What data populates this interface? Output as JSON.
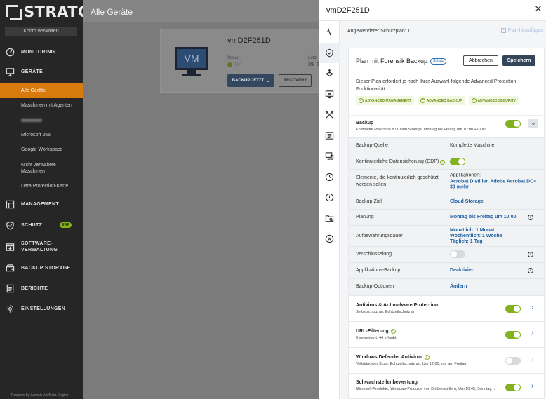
{
  "sidebar": {
    "logo": "STRATO",
    "account_button": "Konto verwalten",
    "sections": {
      "monitoring": "MONITORING",
      "devices": "GERÄTE",
      "management": "MANAGEMENT",
      "protection": "SCHUTZ",
      "protection_badge": "EAP",
      "software": "SOFTWARE-\nVERWALTUNG",
      "storage": "BACKUP STORAGE",
      "reports": "BERICHTE",
      "settings": "EINSTELLUNGEN"
    },
    "device_items": {
      "all": "Alle Geräte",
      "with_agents": "Maschinen mit Agenten",
      "m365": "Microsoft 365",
      "gworkspace": "Google Workspace",
      "unmanaged": "Nicht verwaltete Maschinen",
      "dp_map": "Data Protection-Karte"
    },
    "footer": "Powered by Acronis AnyData Engine"
  },
  "main": {
    "title": "Alle Geräte",
    "device": {
      "name": "vmD2F251D",
      "icon_text": "VM",
      "status_label": "Status",
      "status_value": "OK",
      "last_label": "Letzt",
      "last_value": "29. Ju",
      "backup_now": "BACKUP JETZT",
      "recovery": "RECOVERY"
    }
  },
  "panel": {
    "title": "vmD2F251D",
    "applied_plan": "Angewendeter Schutzplan: 1",
    "add_plan": "Plan hinzufügen",
    "plan": {
      "name": "Plan mit Forensik Backup",
      "badge": "Schutz",
      "cancel": "Abbrechen",
      "save": "Speichern",
      "description": "Dieser Plan erfordert je nach Ihrer Auswahl folgende Advanced Protection-Funktionalität:",
      "features": [
        "ADVANCED MANAGEMENT",
        "ADVANCED BACKUP",
        "ADVANCED SECURITY"
      ]
    },
    "backup": {
      "title": "Backup",
      "subtitle": "Komplette Maschine zu Cloud Storage, Montag bis Freitag um 10:00 + CDP",
      "enabled": true
    },
    "settings": {
      "source_label": "Backup-Quelle",
      "source_value": "Komplette Maschine",
      "cdp_label": "Kontinuierliche Datensicherung (CDP)",
      "cdp_enabled": true,
      "elements_label": "Elemente, die kontinuierlich geschützt werden sollen",
      "elements_prefix": "Applikationen:",
      "elements_value": "Acrobat Distiller, Adobe Acrobat DC+ 39 mehr",
      "target_label": "Backup-Ziel",
      "target_value": "Cloud Storage",
      "schedule_label": "Planung",
      "schedule_value": "Montag bis Freitag um 10:00",
      "retention_label": "Aufbewahrungsdauer",
      "retention_values": [
        "Monatlich: 1 Monat",
        "Wöchentlich: 1 Woche",
        "Täglich: 1 Tag"
      ],
      "encryption_label": "Verschlüsselung",
      "encryption_enabled": false,
      "app_backup_label": "Applikations-Backup",
      "app_backup_value": "Deaktiviert",
      "options_label": "Backup-Optionen",
      "options_value": "Ändern"
    },
    "modules": [
      {
        "title": "Antivirus & Antimalware Protection",
        "subtitle": "Selbstschutz an, Echtzeitschutz an",
        "enabled": true,
        "badge": false
      },
      {
        "title": "URL-Filterung",
        "subtitle": "0 verweigert, 44 erlaubt",
        "enabled": true,
        "badge": true
      },
      {
        "title": "Windows Defender Antivirus",
        "subtitle": "Vollständiger Scan, Echtzeitschutz an, Um 12:00, nur am Freitag",
        "enabled": false,
        "badge": true
      },
      {
        "title": "Schwachstellenbewertung",
        "subtitle": "Microsoft-Produkte, Windows-Produkte von Drittherstellern, Um 10:45, Sonntag ...",
        "enabled": true,
        "badge": false
      }
    ]
  },
  "colors": {
    "accent_orange": "#d97a0c",
    "toggle_green": "#82b21d",
    "link_blue": "#1d5fa6",
    "save_dark": "#34465a"
  }
}
